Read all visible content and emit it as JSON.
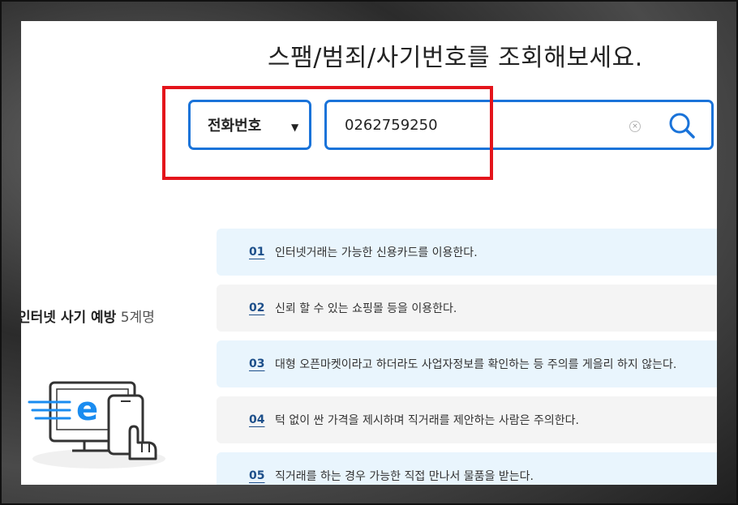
{
  "heading": "스팸/범죄/사기번호를 조회해보세요.",
  "search": {
    "type_selected": "전화번호",
    "query_value": "0262759250"
  },
  "side": {
    "title_main": "인터넷 사기 예방",
    "title_count": "5계명"
  },
  "tips": [
    {
      "num": "01",
      "text": "인터넷거래는 가능한 신용카드를 이용한다."
    },
    {
      "num": "02",
      "text": "신뢰 할 수 있는 쇼핑몰 등을 이용한다."
    },
    {
      "num": "03",
      "text": "대형 오픈마켓이라고 하더라도 사업자정보를 확인하는 등 주의를 게을리 하지 않는다."
    },
    {
      "num": "04",
      "text": "턱 없이 싼 가격을 제시하며 직거래를 제안하는 사람은 주의한다."
    },
    {
      "num": "05",
      "text": "직거래를 하는 경우 가능한 직접 만나서 물품을 받는다."
    }
  ],
  "colors": {
    "accent": "#1a73d9",
    "highlight": "#e4141b",
    "tip_blue": "#e9f5fd",
    "tip_gray": "#f4f4f4",
    "tip_number": "#1d4f8a"
  },
  "icons": {
    "caret": "caret-down-icon",
    "clear": "clear-icon",
    "search": "search-icon",
    "illustration": "e-commerce-monitor-phone-illustration"
  }
}
